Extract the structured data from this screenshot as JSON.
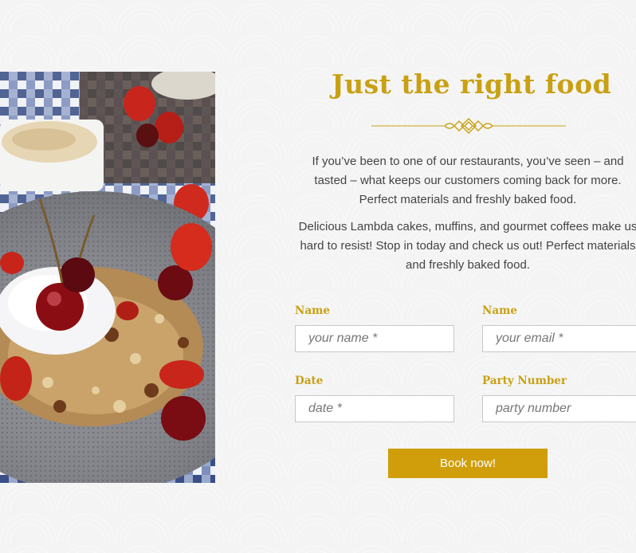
{
  "title": "Just the right food",
  "paragraphs": [
    "If you’ve been to one of our restaurants, you’ve seen – and tasted – what keeps our customers coming back for more. Perfect materials and freshly baked food.",
    "Delicious Lambda cakes,  muffins, and gourmet coffees make us hard to resist! Stop in today and check us out! Perfect materials and freshly baked food."
  ],
  "form": {
    "name_label": "Name",
    "name_placeholder": "your name *",
    "email_label": "Name",
    "email_placeholder": "your email *",
    "date_label": "Date",
    "date_placeholder": "date *",
    "party_label": "Party Number",
    "party_placeholder": "party number",
    "submit_label": "Book now!"
  },
  "colors": {
    "accent": "#c9a012",
    "button": "#cf9e0a",
    "text": "#444444",
    "background": "#f4f4f4"
  },
  "icons": {
    "ornament": "ornament-divider-icon"
  }
}
